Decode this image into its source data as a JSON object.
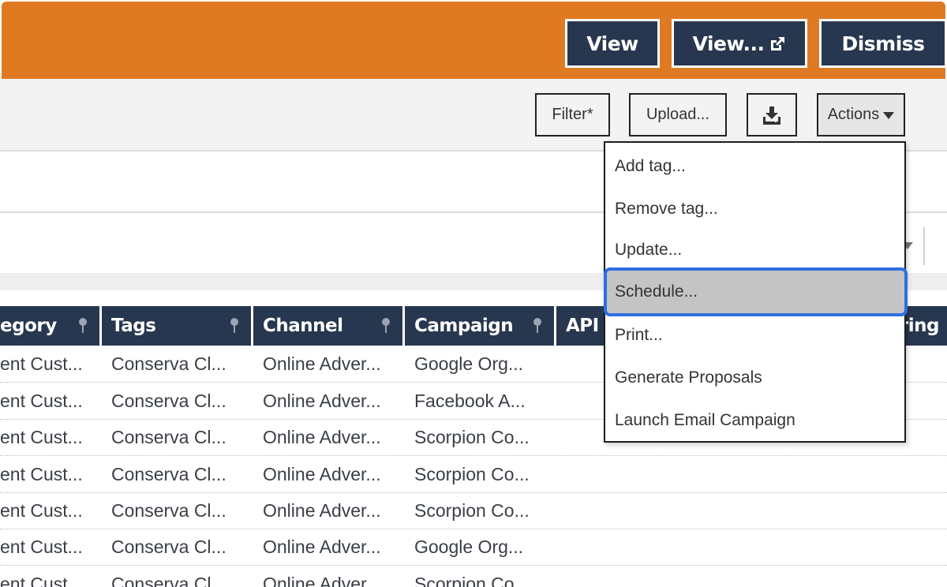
{
  "banner": {
    "view_label": "View",
    "view_external_label": "View...",
    "dismiss_label": "Dismiss",
    "bg_color": "#e07a22",
    "button_color": "#27374f"
  },
  "toolbar": {
    "filter_label": "Filter*",
    "upload_label": "Upload...",
    "download_icon": "download-icon",
    "actions_label": "Actions"
  },
  "grid": {
    "headers": [
      {
        "label": "egory"
      },
      {
        "label": "Tags"
      },
      {
        "label": "Channel"
      },
      {
        "label": "Campaign"
      },
      {
        "label": "API"
      },
      {
        "label": "ring"
      }
    ],
    "rows": [
      [
        "ent Cust...",
        "Conserva Cl...",
        "Online Adver...",
        "Google Org..."
      ],
      [
        "ent Cust...",
        "Conserva Cl...",
        "Online Adver...",
        "Facebook A..."
      ],
      [
        "ent Cust...",
        "Conserva Cl...",
        "Online Adver...",
        "Scorpion Co..."
      ],
      [
        "ent Cust...",
        "Conserva Cl...",
        "Online Adver...",
        "Scorpion Co..."
      ],
      [
        "ent Cust...",
        "Conserva Cl...",
        "Online Adver...",
        "Scorpion Co..."
      ],
      [
        "ent Cust...",
        "Conserva Cl...",
        "Online Adver...",
        "Google Org..."
      ],
      [
        "ent Cust...",
        "Conserva Cl...",
        "Online Adver...",
        "Scorpion Co..."
      ]
    ]
  },
  "actions_menu": {
    "items": [
      {
        "label": "Add tag..."
      },
      {
        "label": "Remove tag..."
      },
      {
        "label": "Update..."
      },
      {
        "label": "Schedule...",
        "highlighted": true
      },
      {
        "label": "Print..."
      },
      {
        "label": "Generate Proposals"
      },
      {
        "label": "Launch Email Campaign"
      }
    ],
    "highlight_color": "#2e6fe0"
  }
}
